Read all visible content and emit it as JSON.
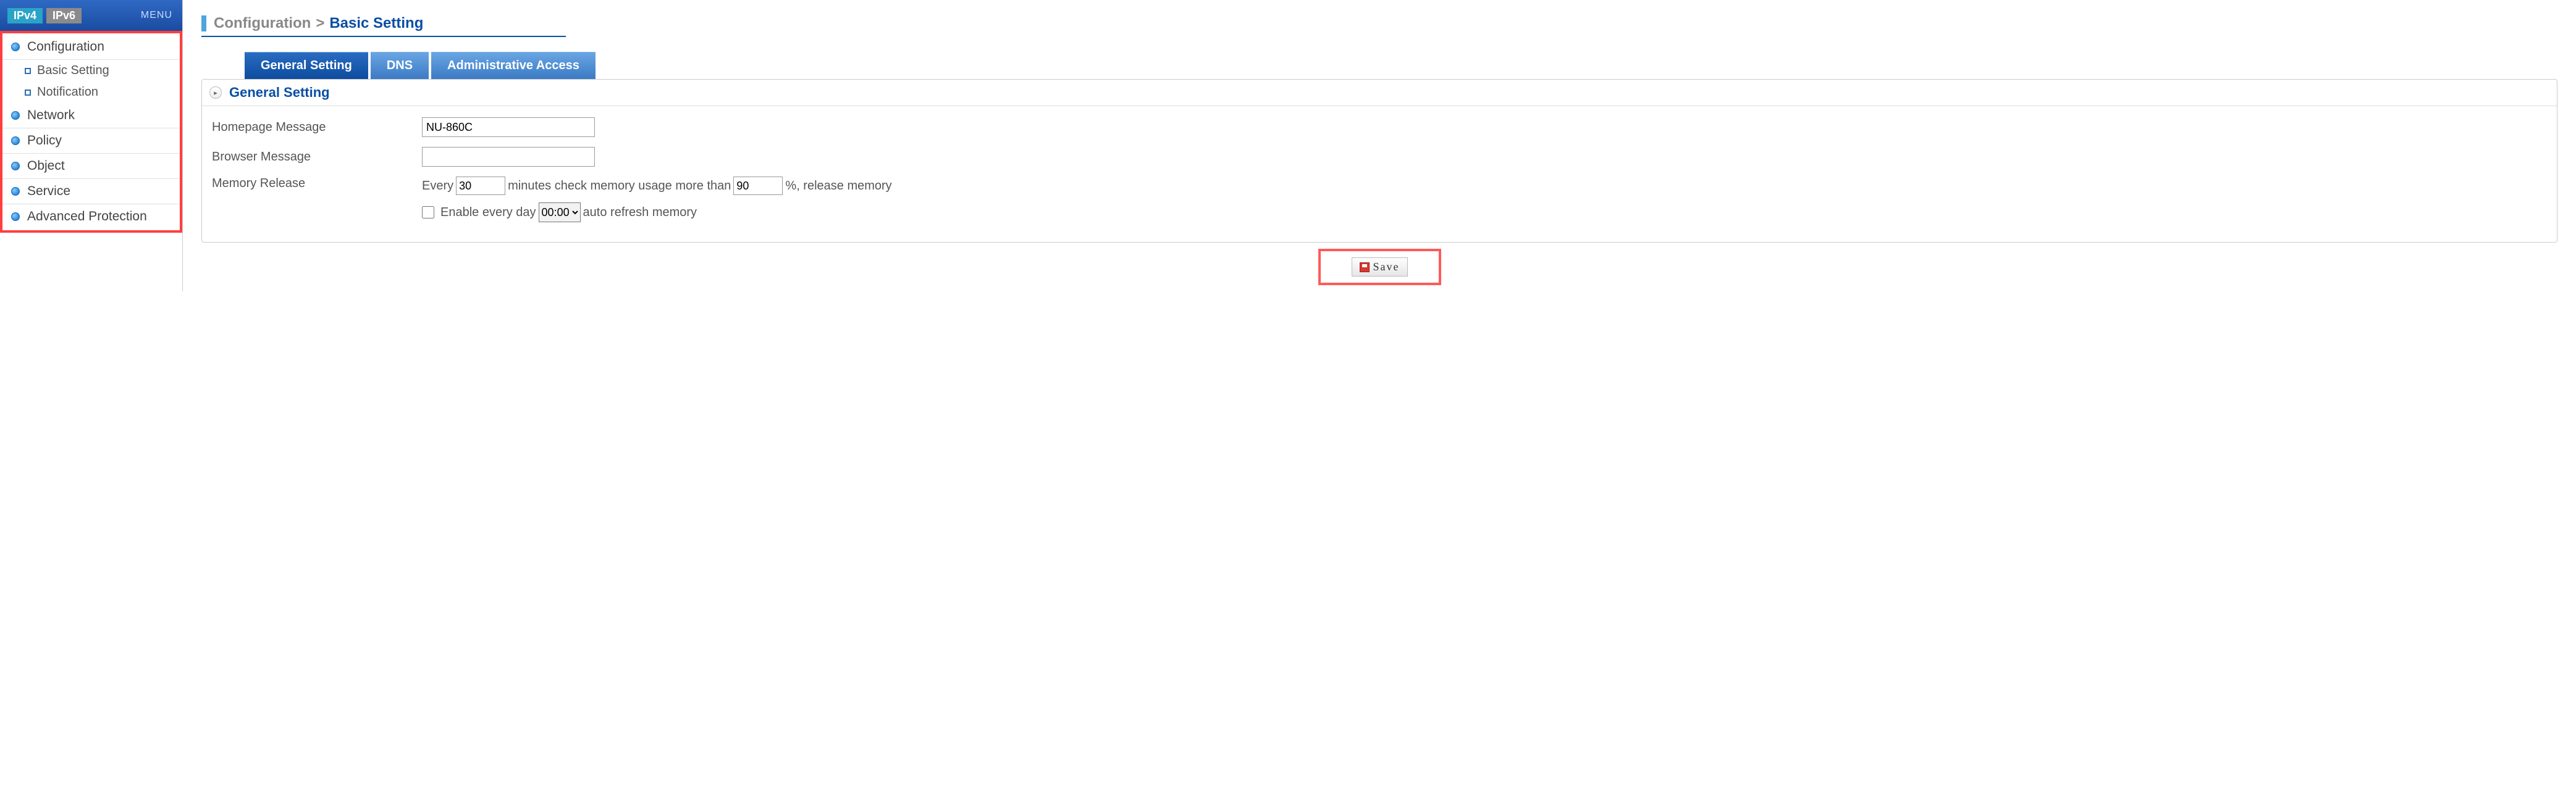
{
  "sidebar": {
    "ipv4_label": "IPv4",
    "ipv6_label": "IPv6",
    "menu_label": "MENU",
    "items": [
      {
        "label": "Configuration",
        "children": [
          {
            "label": "Basic Setting"
          },
          {
            "label": "Notification"
          }
        ]
      },
      {
        "label": "Network"
      },
      {
        "label": "Policy"
      },
      {
        "label": "Object"
      },
      {
        "label": "Service"
      },
      {
        "label": "Advanced Protection"
      }
    ]
  },
  "breadcrumb": {
    "root": "Configuration",
    "sep": ">",
    "current": "Basic Setting"
  },
  "tabs": [
    {
      "label": "General Setting",
      "active": true
    },
    {
      "label": "DNS",
      "active": false
    },
    {
      "label": "Administrative Access",
      "active": false
    }
  ],
  "panel": {
    "title": "General Setting",
    "homepage_label": "Homepage Message",
    "homepage_value": "NU-860C",
    "browser_label": "Browser Message",
    "browser_value": "",
    "memory_label": "Memory Release",
    "mem_text1": "Every",
    "mem_minutes": "30",
    "mem_text2": "minutes check memory usage more than",
    "mem_percent": "90",
    "mem_text3": "%, release memory",
    "mem_enable_label": "Enable  every day",
    "mem_time_value": "00:00",
    "mem_text4": "auto refresh memory",
    "save_label": "Save"
  }
}
